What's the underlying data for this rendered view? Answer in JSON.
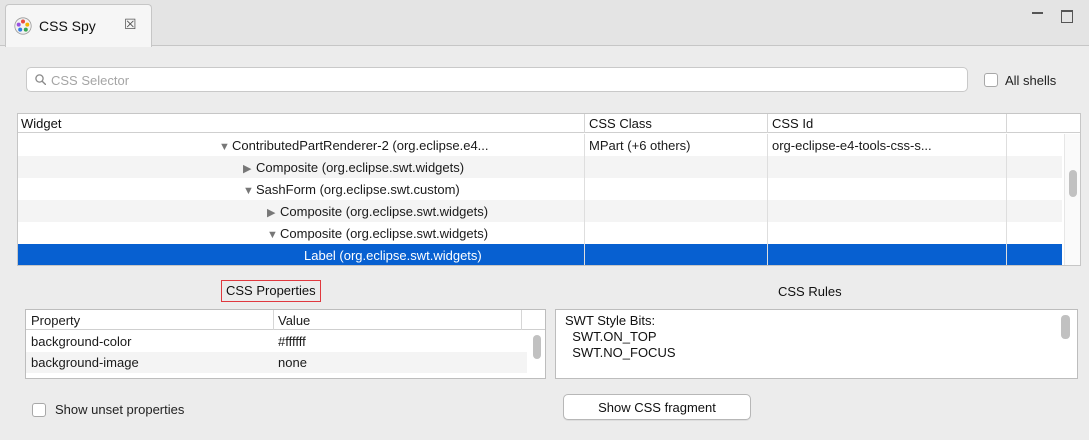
{
  "tab": {
    "title": "CSS Spy",
    "icon": "palette-icon",
    "close_glyph": "☒"
  },
  "window_controls": {
    "minimize": "minimize-icon",
    "maximize": "maximize-icon"
  },
  "search": {
    "placeholder": "CSS Selector",
    "value": ""
  },
  "all_shells": {
    "label": "All shells",
    "checked": false
  },
  "tree": {
    "columns": [
      "Widget",
      "CSS Class",
      "CSS Id"
    ],
    "rows": [
      {
        "indent": 10,
        "expander": "▼",
        "widget": "ContributedPartRenderer-2 (org.eclipse.e4...",
        "css_class": "MPart (+6 others)",
        "css_id": "org-eclipse-e4-tools-css-s...",
        "selected": false
      },
      {
        "indent": 11,
        "expander": "▶",
        "widget": "Composite (org.eclipse.swt.widgets)",
        "css_class": "",
        "css_id": "",
        "selected": false
      },
      {
        "indent": 11,
        "expander": "▼",
        "widget": "SashForm (org.eclipse.swt.custom)",
        "css_class": "",
        "css_id": "",
        "selected": false
      },
      {
        "indent": 12,
        "expander": "▶",
        "widget": "Composite (org.eclipse.swt.widgets)",
        "css_class": "",
        "css_id": "",
        "selected": false
      },
      {
        "indent": 12,
        "expander": "▼",
        "widget": "Composite (org.eclipse.swt.widgets)",
        "css_class": "",
        "css_id": "",
        "selected": false
      },
      {
        "indent": 13,
        "expander": "",
        "widget": "Label (org.eclipse.swt.widgets)",
        "css_class": "",
        "css_id": "",
        "selected": true
      }
    ]
  },
  "css_properties": {
    "label": "CSS Properties",
    "columns": [
      "Property",
      "Value"
    ],
    "rows": [
      {
        "property": "background-color",
        "value": "#ffffff"
      },
      {
        "property": "background-image",
        "value": "none"
      }
    ]
  },
  "css_rules": {
    "label": "CSS Rules",
    "text": "SWT Style Bits:\n  SWT.ON_TOP\n  SWT.NO_FOCUS"
  },
  "show_unset": {
    "label": "Show unset properties",
    "checked": false
  },
  "show_fragment_button": "Show CSS fragment",
  "colors": {
    "selection": "#0760d1",
    "highlight_box": "#e0383e"
  }
}
